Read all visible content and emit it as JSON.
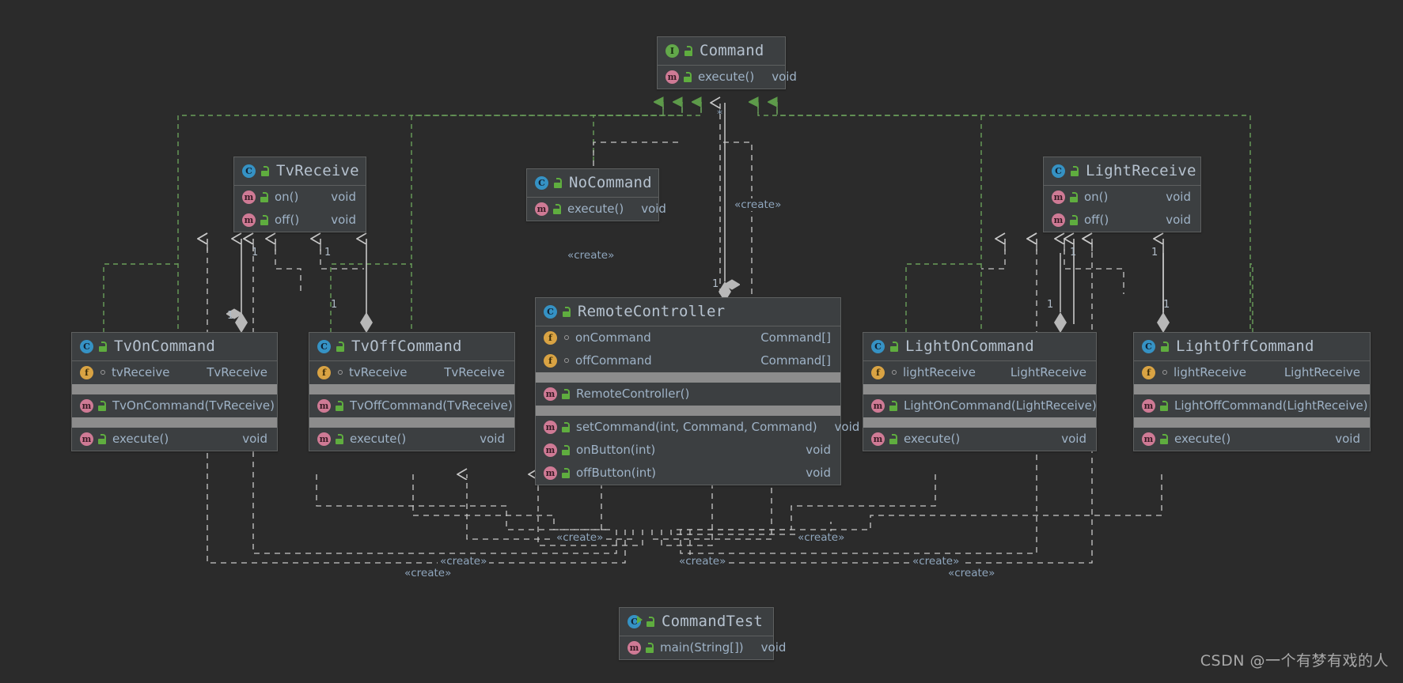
{
  "diagram": {
    "kind": "uml-class-diagram",
    "background": "#2b2b2b",
    "watermark": "CSDN @一个有梦有戏的人",
    "legend": {
      "icon_class": "C",
      "icon_interface": "I",
      "icon_method": "m",
      "icon_field": "f"
    }
  },
  "classes": {
    "command": {
      "name": "Command",
      "stereotype": "interface",
      "icon": "interface-icon",
      "visibility_icon": "public-unlocked-icon",
      "members": [
        {
          "name": "execute()",
          "type": "void",
          "icon": "method-icon",
          "visibility_icon": "public-unlocked-icon"
        }
      ]
    },
    "tv_receive": {
      "name": "TvReceive",
      "stereotype": "class",
      "icon": "class-icon",
      "visibility_icon": "public-unlocked-icon",
      "members": [
        {
          "name": "on()",
          "type": "void",
          "icon": "method-icon",
          "visibility_icon": "public-unlocked-icon"
        },
        {
          "name": "off()",
          "type": "void",
          "icon": "method-icon",
          "visibility_icon": "public-unlocked-icon"
        }
      ]
    },
    "no_command": {
      "name": "NoCommand",
      "stereotype": "class",
      "icon": "class-icon",
      "visibility_icon": "public-unlocked-icon",
      "members": [
        {
          "name": "execute()",
          "type": "void",
          "icon": "method-icon",
          "visibility_icon": "public-unlocked-icon"
        }
      ]
    },
    "light_receive": {
      "name": "LightReceive",
      "stereotype": "class",
      "icon": "class-icon",
      "visibility_icon": "public-unlocked-icon",
      "members": [
        {
          "name": "on()",
          "type": "void",
          "icon": "method-icon",
          "visibility_icon": "public-unlocked-icon"
        },
        {
          "name": "off()",
          "type": "void",
          "icon": "method-icon",
          "visibility_icon": "public-unlocked-icon"
        }
      ]
    },
    "remote_controller": {
      "name": "RemoteController",
      "stereotype": "class",
      "icon": "class-icon",
      "visibility_icon": "public-unlocked-icon",
      "fields": [
        {
          "name": "onCommand",
          "type": "Command[]",
          "icon": "field-icon",
          "visibility_icon": "package-private-icon"
        },
        {
          "name": "offCommand",
          "type": "Command[]",
          "icon": "field-icon",
          "visibility_icon": "package-private-icon"
        }
      ],
      "constructors": [
        {
          "name": "RemoteController()",
          "type": "",
          "icon": "method-icon",
          "visibility_icon": "public-unlocked-icon"
        }
      ],
      "methods": [
        {
          "name": "setCommand(int, Command, Command)",
          "type": "void",
          "icon": "method-icon",
          "visibility_icon": "public-unlocked-icon"
        },
        {
          "name": "onButton(int)",
          "type": "void",
          "icon": "method-icon",
          "visibility_icon": "public-unlocked-icon"
        },
        {
          "name": "offButton(int)",
          "type": "void",
          "icon": "method-icon",
          "visibility_icon": "public-unlocked-icon"
        }
      ]
    },
    "tv_on_command": {
      "name": "TvOnCommand",
      "stereotype": "class",
      "icon": "class-icon",
      "visibility_icon": "public-unlocked-icon",
      "fields": [
        {
          "name": "tvReceive",
          "type": "TvReceive",
          "icon": "field-icon",
          "visibility_icon": "package-private-icon"
        }
      ],
      "constructors": [
        {
          "name": "TvOnCommand(TvReceive)",
          "type": "",
          "icon": "method-icon",
          "visibility_icon": "public-unlocked-icon"
        }
      ],
      "methods": [
        {
          "name": "execute()",
          "type": "void",
          "icon": "method-icon",
          "visibility_icon": "public-unlocked-icon"
        }
      ]
    },
    "tv_off_command": {
      "name": "TvOffCommand",
      "stereotype": "class",
      "icon": "class-icon",
      "visibility_icon": "public-unlocked-icon",
      "fields": [
        {
          "name": "tvReceive",
          "type": "TvReceive",
          "icon": "field-icon",
          "visibility_icon": "package-private-icon"
        }
      ],
      "constructors": [
        {
          "name": "TvOffCommand(TvReceive)",
          "type": "",
          "icon": "method-icon",
          "visibility_icon": "public-unlocked-icon"
        }
      ],
      "methods": [
        {
          "name": "execute()",
          "type": "void",
          "icon": "method-icon",
          "visibility_icon": "public-unlocked-icon"
        }
      ]
    },
    "light_on_command": {
      "name": "LightOnCommand",
      "stereotype": "class",
      "icon": "class-icon",
      "visibility_icon": "public-unlocked-icon",
      "fields": [
        {
          "name": "lightReceive",
          "type": "LightReceive",
          "icon": "field-icon",
          "visibility_icon": "package-private-icon"
        }
      ],
      "constructors": [
        {
          "name": "LightOnCommand(LightReceive)",
          "type": "",
          "icon": "method-icon",
          "visibility_icon": "public-unlocked-icon"
        }
      ],
      "methods": [
        {
          "name": "execute()",
          "type": "void",
          "icon": "method-icon",
          "visibility_icon": "public-unlocked-icon"
        }
      ]
    },
    "light_off_command": {
      "name": "LightOffCommand",
      "stereotype": "class",
      "icon": "class-icon",
      "visibility_icon": "public-unlocked-icon",
      "fields": [
        {
          "name": "lightReceive",
          "type": "LightReceive",
          "icon": "field-icon",
          "visibility_icon": "package-private-icon"
        }
      ],
      "constructors": [
        {
          "name": "LightOffCommand(LightReceive)",
          "type": "",
          "icon": "method-icon",
          "visibility_icon": "public-unlocked-icon"
        }
      ],
      "methods": [
        {
          "name": "execute()",
          "type": "void",
          "icon": "method-icon",
          "visibility_icon": "public-unlocked-icon"
        }
      ]
    },
    "command_test": {
      "name": "CommandTest",
      "stereotype": "class",
      "icon": "runnable-class-icon",
      "visibility_icon": "public-unlocked-icon",
      "members": [
        {
          "name": "main(String[])",
          "type": "void",
          "icon": "method-icon",
          "visibility_icon": "public-unlocked-icon"
        }
      ]
    }
  },
  "edge_labels": {
    "create_remote_to_no": "«create»",
    "create_no_to_remote": "«create»",
    "create_test_1": "«create»",
    "create_test_2": "«create»",
    "create_test_3": "«create»",
    "create_test_4": "«create»",
    "create_test_5": "«create»",
    "create_test_6": "«create»"
  },
  "multiplicities": {
    "m1": "1",
    "m2": "1",
    "m3": "1",
    "m4": "1",
    "m5": "1",
    "m6": "1",
    "m7": "1",
    "m8": "1",
    "m9": "1",
    "star": "*"
  },
  "colors": {
    "background": "#2b2b2b",
    "box_fill": "#3c3f41",
    "box_border": "#5e6060",
    "band": "#8c8c8c",
    "realization": "#6a9f5b",
    "dependency": "#c8c8c8",
    "aggregation": "#c8c8c8",
    "title_text": "#b6c2cf",
    "member_text": "#9fb3c7",
    "icon_class": "#3592c4",
    "icon_interface": "#62a84a",
    "icon_method": "#cf7a95",
    "icon_field": "#d9a343"
  }
}
